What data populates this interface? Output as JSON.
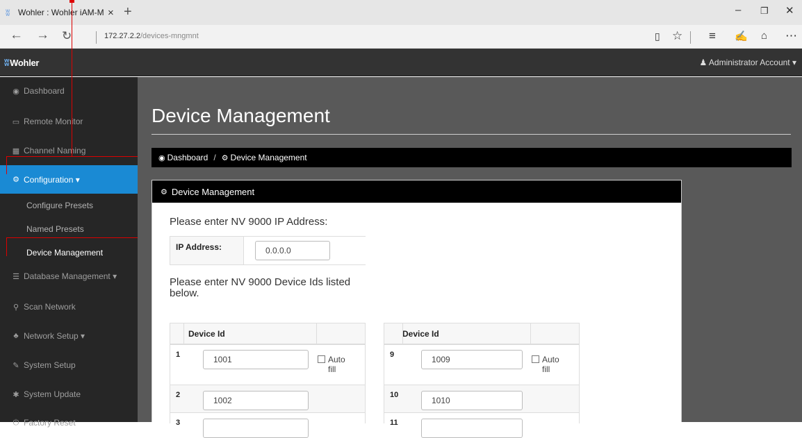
{
  "browser": {
    "tab_title": "Wohler : Wohler iAM-M",
    "tab_close": "×",
    "new_tab": "+",
    "url_host": "172.27.2.2",
    "url_path": "/devices-mngmnt",
    "icons": [
      "back-icon",
      "forward-icon",
      "refresh-icon",
      "reading-view-icon",
      "favorite-star-icon",
      "hub-icon",
      "web-note-icon",
      "share-icon",
      "more-icon"
    ]
  },
  "topbar": {
    "logo_text": "Wohler",
    "account_label": "Administrator Account",
    "account_caret": "▾"
  },
  "sidebar": {
    "items": [
      {
        "label": "Dashboard",
        "icon": "dashboard-icon",
        "glyph": "◉"
      },
      {
        "label": "Remote Monitor",
        "icon": "monitor-icon",
        "glyph": "▭"
      },
      {
        "label": "Channel Naming",
        "icon": "grid-icon",
        "glyph": "▦"
      },
      {
        "label": "Configuration",
        "icon": "cogs-icon",
        "glyph": "⚙",
        "caret": "▾"
      },
      {
        "label": "Configure Presets"
      },
      {
        "label": "Named Presets"
      },
      {
        "label": "Device Management"
      },
      {
        "label": "Database Management",
        "icon": "database-icon",
        "glyph": "☰",
        "caret": "▾"
      },
      {
        "label": "Scan Network",
        "icon": "search-icon",
        "glyph": "⚲"
      },
      {
        "label": "Network Setup",
        "icon": "sitemap-icon",
        "glyph": "♣",
        "caret": "▾"
      },
      {
        "label": "System Setup",
        "icon": "wrench-icon",
        "glyph": "✎"
      },
      {
        "label": "System Update",
        "icon": "gear-icon",
        "glyph": "✱"
      },
      {
        "label": "Factory Reset",
        "icon": "power-icon",
        "glyph": "⏻"
      }
    ]
  },
  "main": {
    "title": "Device Management",
    "breadcrumb": {
      "home": "Dashboard",
      "separator": "/",
      "current": "Device Management"
    },
    "panel": {
      "title": "Device Management",
      "ip_prompt": "Please enter NV 9000 IP Address:",
      "ip_label": "IP Address:",
      "ip_value": "0.0.0.0",
      "ids_prompt_line1": "Please enter NV 9000 Device Ids listed",
      "ids_prompt_line2": "below.",
      "column_header": "Device Id",
      "autofill_line1": "Auto",
      "autofill_line2": "fill",
      "left_rows": [
        {
          "num": "1",
          "value": "1001"
        },
        {
          "num": "2",
          "value": "1002"
        },
        {
          "num": "3",
          "value": ""
        }
      ],
      "right_rows": [
        {
          "num": "9",
          "value": "1009"
        },
        {
          "num": "10",
          "value": "1010"
        },
        {
          "num": "11",
          "value": ""
        }
      ]
    }
  },
  "colors": {
    "sidebar_bg": "#262626",
    "active_blue": "#1a8ad4",
    "main_bg": "#595959",
    "annotation_red": "#d00"
  }
}
